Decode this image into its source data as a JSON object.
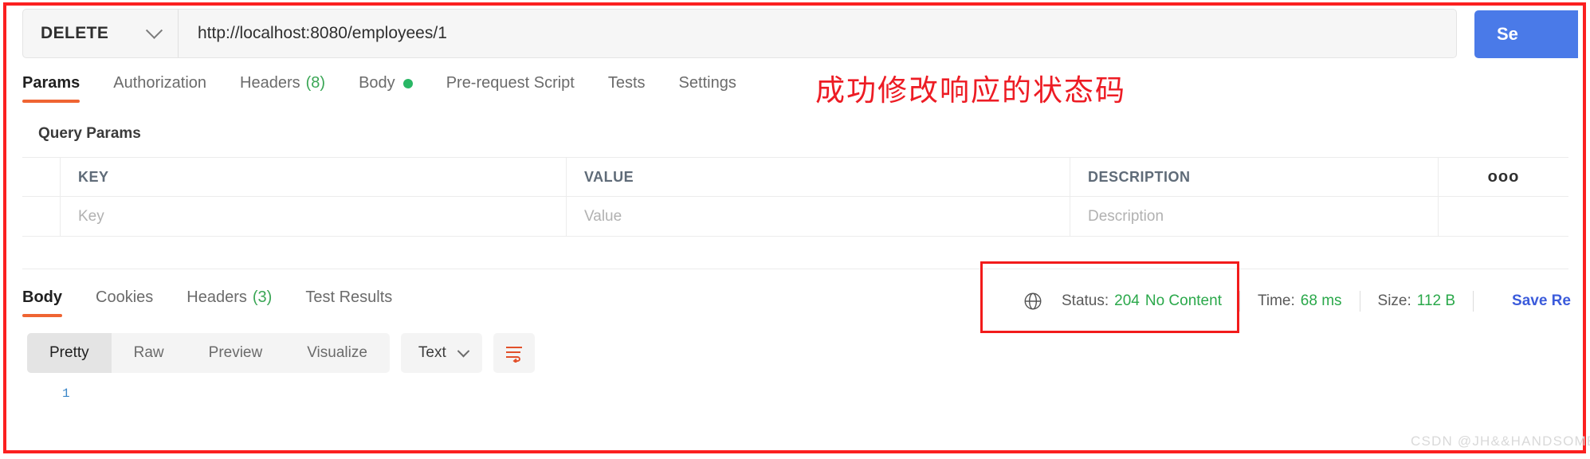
{
  "request": {
    "method": "DELETE",
    "url": "http://localhost:8080/employees/1",
    "send_label": "Se",
    "tabs": [
      {
        "label": "Params",
        "count": "",
        "dot": false
      },
      {
        "label": "Authorization",
        "count": "",
        "dot": false
      },
      {
        "label": "Headers",
        "count": "(8)",
        "dot": false
      },
      {
        "label": "Body",
        "count": "",
        "dot": true
      },
      {
        "label": "Pre-request Script",
        "count": "",
        "dot": false
      },
      {
        "label": "Tests",
        "count": "",
        "dot": false
      },
      {
        "label": "Settings",
        "count": "",
        "dot": false
      }
    ]
  },
  "annotation": {
    "text": "成功修改响应的状态码",
    "color": "#ed1c24"
  },
  "query_params": {
    "title": "Query Params",
    "headers": {
      "key": "KEY",
      "value": "VALUE",
      "description": "DESCRIPTION",
      "options": "ooo"
    },
    "rows": [
      {
        "key": "Key",
        "value": "Value",
        "description": "Description"
      }
    ]
  },
  "response": {
    "tabs": [
      {
        "label": "Body",
        "count": ""
      },
      {
        "label": "Cookies",
        "count": ""
      },
      {
        "label": "Headers",
        "count": "(3)"
      },
      {
        "label": "Test Results",
        "count": ""
      }
    ],
    "status_label": "Status:",
    "status_code": "204",
    "status_text": "No Content",
    "time_label": "Time:",
    "time_value": "68 ms",
    "size_label": "Size:",
    "size_value": "112 B",
    "save_response": "Save Re",
    "status_color": "#2aa84a",
    "view_modes": [
      "Pretty",
      "Raw",
      "Preview",
      "Visualize"
    ],
    "content_type": "Text",
    "line_number": "1"
  },
  "watermark": "CSDN @JH&&HANDSOME"
}
